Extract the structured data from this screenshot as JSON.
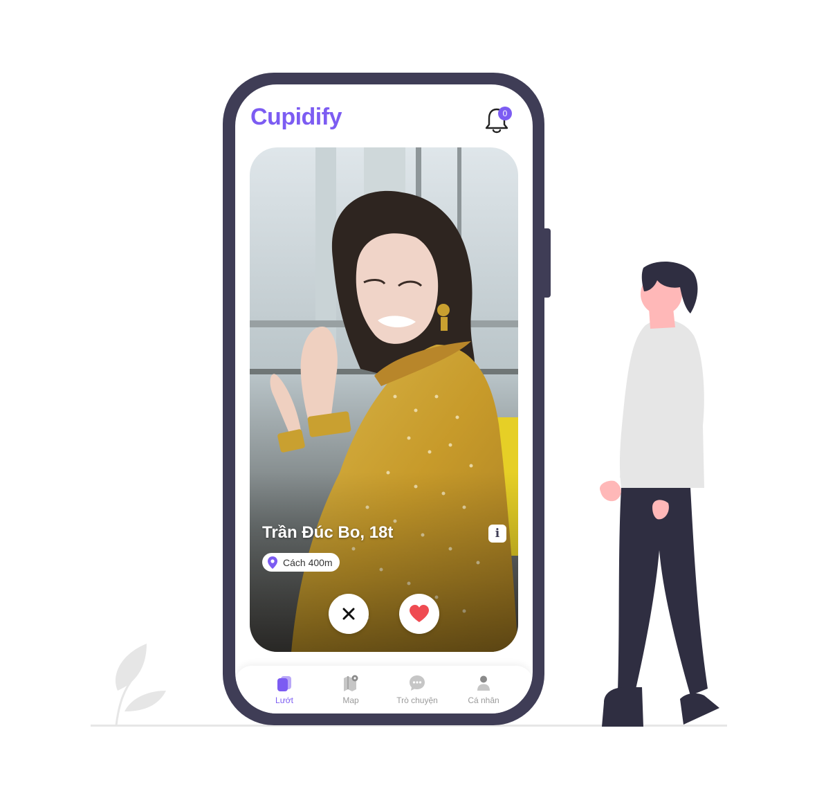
{
  "app": {
    "brand": "Cupidify",
    "notifications": {
      "count": "0",
      "icon": "bell-icon"
    }
  },
  "profile": {
    "name": "Trần Đúc Bo, 18t",
    "distance": "Cách 400m",
    "info_icon": "i"
  },
  "actions": {
    "dislike_icon": "close-icon",
    "like_icon": "heart-icon"
  },
  "nav": {
    "items": [
      {
        "label": "Lướt",
        "icon": "cards-icon",
        "active": true
      },
      {
        "label": "Map",
        "icon": "map-icon",
        "active": false
      },
      {
        "label": "Trò chuyện",
        "icon": "chat-icon",
        "active": false
      },
      {
        "label": "Cá nhân",
        "icon": "user-icon",
        "active": false
      }
    ]
  },
  "colors": {
    "accent": "#7c5cf2",
    "phone_frame": "#3f3d56",
    "like": "#ef4b52",
    "person_skin": "#ffb8b8",
    "person_shirt": "#e6e6e6"
  }
}
